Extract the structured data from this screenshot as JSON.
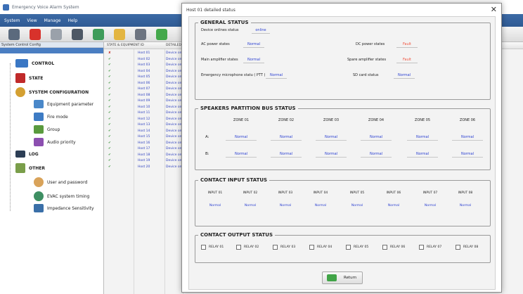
{
  "app": {
    "title": "Emergency Voice Alarm System",
    "menu": [
      "System",
      "View",
      "Manage",
      "Help"
    ]
  },
  "sidebar": {
    "header": "System Control Config",
    "items": [
      {
        "label": "CONTROL",
        "category": true
      },
      {
        "label": "STATE",
        "category": true
      },
      {
        "label": "SYSTEM CONFIGURATION",
        "category": true
      },
      {
        "label": "Equipment parameter",
        "category": false
      },
      {
        "label": "Fire mode",
        "category": false
      },
      {
        "label": "Group",
        "category": false
      },
      {
        "label": "Audio priority",
        "category": false
      },
      {
        "label": "LOG",
        "category": true
      },
      {
        "label": "OTHER",
        "category": true
      },
      {
        "label": "User and password",
        "category": false
      },
      {
        "label": "EVAC system timing",
        "category": false
      },
      {
        "label": "Impedance Sensitivity",
        "category": false
      }
    ]
  },
  "grid": {
    "columns": [
      "STATE & EQUIPMENT ID",
      "DETAILED"
    ],
    "detail_text": "Device on",
    "rows": [
      {
        "status": "✘",
        "host": "Host 01"
      },
      {
        "status": "✔",
        "host": "Host 02"
      },
      {
        "status": "✔",
        "host": "Host 03"
      },
      {
        "status": "✔",
        "host": "Host 04"
      },
      {
        "status": "✔",
        "host": "Host 05"
      },
      {
        "status": "✔",
        "host": "Host 06"
      },
      {
        "status": "✔",
        "host": "Host 07"
      },
      {
        "status": "✔",
        "host": "Host 08"
      },
      {
        "status": "✔",
        "host": "Host 09"
      },
      {
        "status": "✔",
        "host": "Host 10"
      },
      {
        "status": "✔",
        "host": "Host 11"
      },
      {
        "status": "✔",
        "host": "Host 12"
      },
      {
        "status": "✔",
        "host": "Host 13"
      },
      {
        "status": "✔",
        "host": "Host 14"
      },
      {
        "status": "✔",
        "host": "Host 15"
      },
      {
        "status": "✔",
        "host": "Host 16"
      },
      {
        "status": "✔",
        "host": "Host 17"
      },
      {
        "status": "✔",
        "host": "Host 18"
      },
      {
        "status": "✔",
        "host": "Host 19"
      },
      {
        "status": "✔",
        "host": "Host 20"
      }
    ]
  },
  "dialog": {
    "title": "Host 01 detailed status",
    "close": "✕",
    "general": {
      "title": "GENERAL STATUS",
      "device_online_label": "Device onlines status",
      "device_online_value": "online",
      "ac_power_label": "AC power states",
      "ac_power_value": "Normal",
      "dc_power_label": "DC power states",
      "dc_power_value": "Fault",
      "main_amp_label": "Main amplifier states",
      "main_amp_value": "Normal",
      "spare_amp_label": "Spare amplifier states",
      "spare_amp_value": "Fault",
      "emergency_mic_label": "Emergency microphone statu ( PTT )",
      "emergency_mic_value": "Normal",
      "sd_card_label": "SD card status",
      "sd_card_value": "Normal"
    },
    "speakers": {
      "title": "SPEAKERS PARTITION BUS STATUS",
      "zones": [
        "ZONE 01",
        "ZONE 02",
        "ZONE 03",
        "ZONE 04",
        "ZONE 05",
        "ZONE 06"
      ],
      "row_a_label": "A:",
      "row_b_label": "B:",
      "row_a": [
        "Normal",
        "Normal",
        "Normal",
        "Normal",
        "Normal",
        "Normal"
      ],
      "row_b": [
        "Normal",
        "Normal",
        "Normal",
        "Normal",
        "Normal",
        "Normal"
      ]
    },
    "contact_input": {
      "title": "CONTACT INPUT STATUS",
      "inputs": [
        "INPUT 01",
        "INPUT 02",
        "INPUT 03",
        "INPUT 04",
        "INPUT 05",
        "INPUT 06",
        "INPUT 07",
        "INPUT 08"
      ],
      "values": [
        "Normal",
        "Normal",
        "Normal",
        "Normal",
        "Normal",
        "Normal",
        "Normal",
        "Normal"
      ]
    },
    "contact_output": {
      "title": "CONTACT OUTPUT STATUS",
      "relays": [
        "RELAY 01",
        "RELAY 02",
        "RELAY 03",
        "RELAY 04",
        "RELAY 05",
        "RELAY 06",
        "RELAY 07",
        "RELAY 08"
      ]
    },
    "return_label": "Return"
  },
  "colors": {
    "normal": "#2a3fd1",
    "fault": "#f0533e",
    "ok_check": "#2f8f2f",
    "error_cross": "#c0201a",
    "menubar": "#3c6aa6"
  }
}
